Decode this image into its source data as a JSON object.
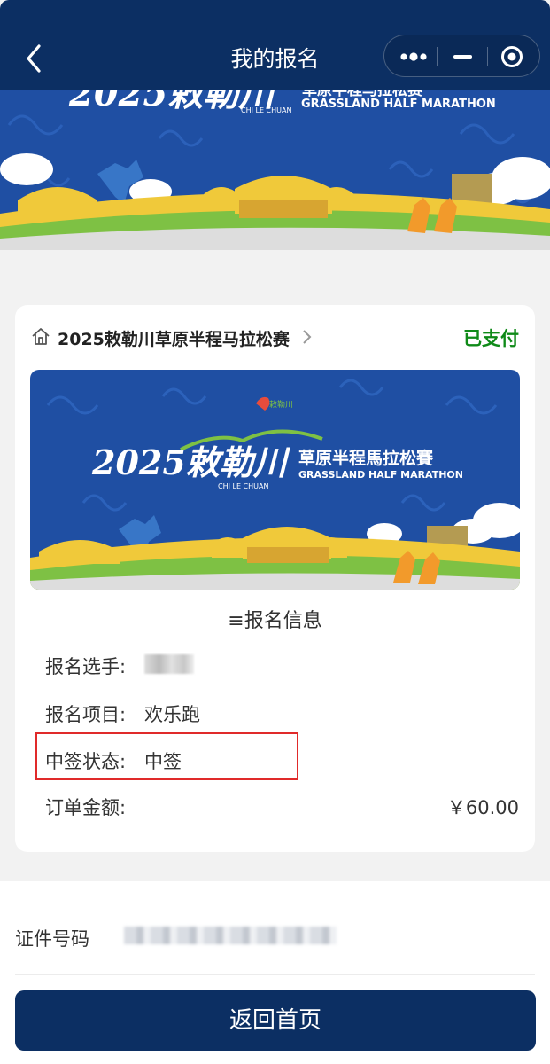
{
  "nav": {
    "title": "我的报名"
  },
  "banner": {
    "year_title": "2025敕勒川",
    "latin": "CHI LE CHUAN",
    "cn_sub": "草原半程马拉松赛",
    "en_sub": "GRASSLAND HALF MARATHON",
    "card_cn_sub": "草原半程馬拉松賽"
  },
  "card": {
    "race_name": "2025敕勒川草原半程马拉松赛",
    "payment_status": "已支付",
    "section_title": "≡报名信息",
    "rows": [
      {
        "label": "报名选手:",
        "value": ""
      },
      {
        "label": "报名项目:",
        "value": "欢乐跑"
      },
      {
        "label": "中签状态:",
        "value": "中签"
      },
      {
        "label": "订单金额:",
        "value": "￥60.00"
      }
    ]
  },
  "id_section": {
    "label": "证件号码",
    "value": ""
  },
  "footer": {
    "home_button": "返回首页"
  },
  "colors": {
    "nav_bg": "#0c2f63",
    "paid_green": "#0f8a18",
    "highlight_red": "#e02a2a",
    "banner_blue": "#1f4fa3"
  }
}
